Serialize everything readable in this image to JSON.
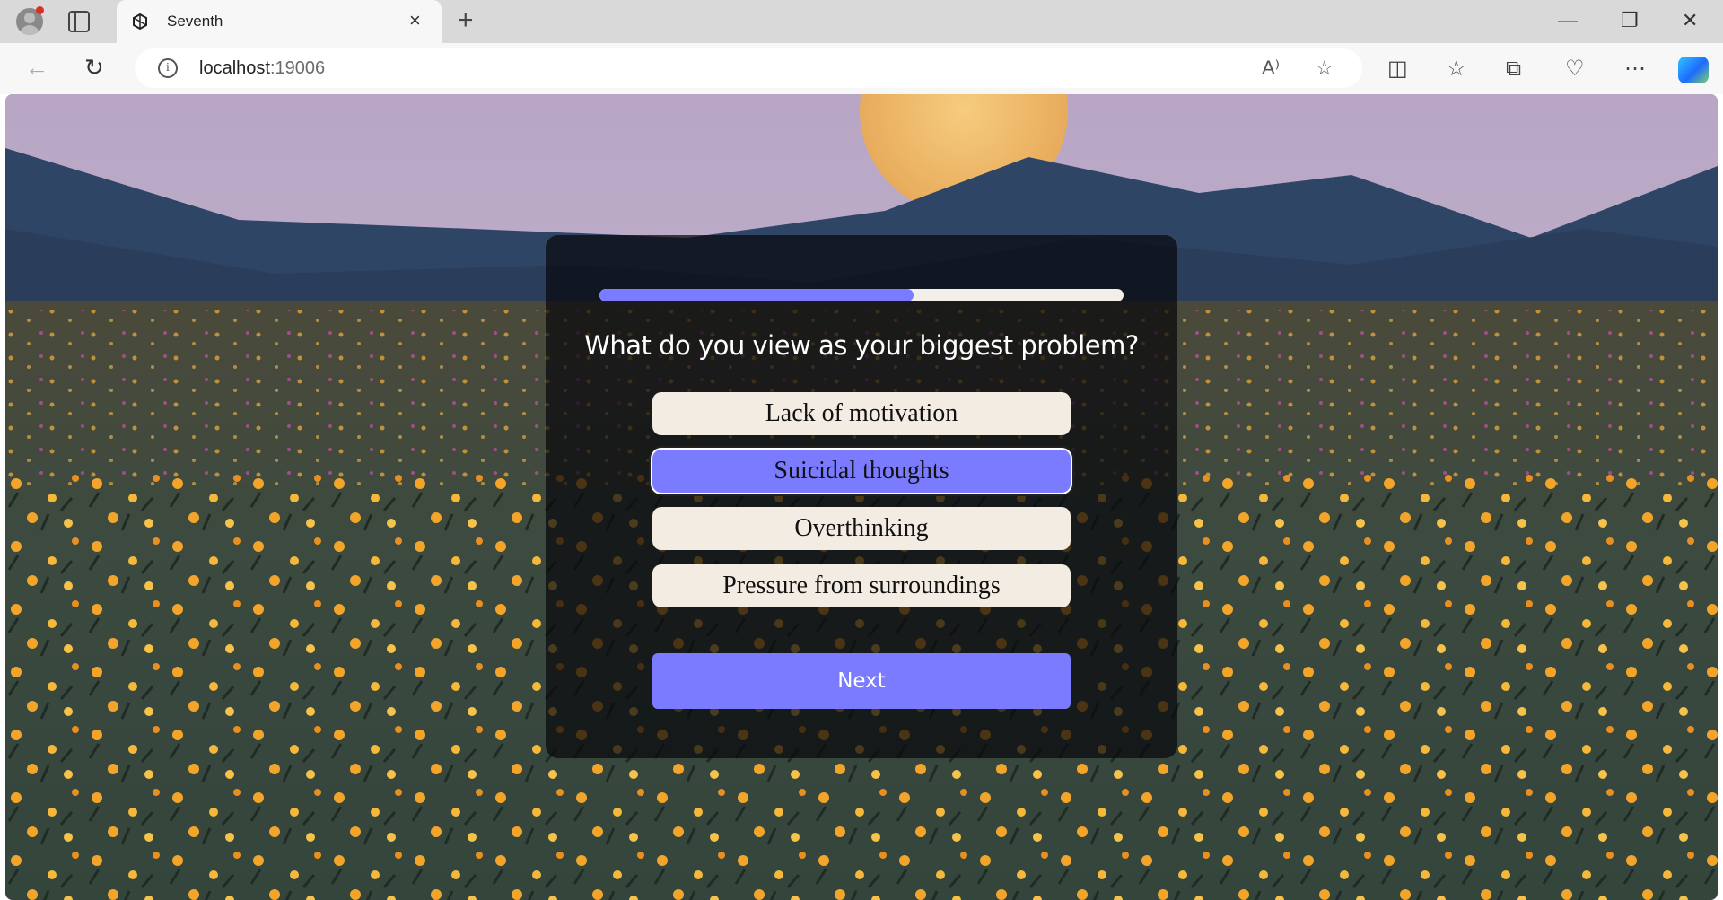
{
  "browser": {
    "tab_title": "Seventh",
    "tab_close": "×",
    "new_tab": "+",
    "url_host": "localhost",
    "url_port": ":19006",
    "window_controls": {
      "minimize": "—",
      "restore": "❐",
      "close": "✕"
    }
  },
  "icons": {
    "back": "arrow-left-icon",
    "refresh": "refresh-icon",
    "info": "info-icon",
    "read_aloud": "read-aloud-icon",
    "favorite": "star-icon",
    "split": "split-screen-icon",
    "favorites": "favorites-icon",
    "collections": "collections-icon",
    "health": "browser-essentials-icon",
    "more": "more-icon",
    "copilot": "copilot-icon"
  },
  "quiz": {
    "progress": 0.6,
    "question": "What do you view as your biggest problem?",
    "options": [
      {
        "label": "Lack of motivation",
        "selected": false
      },
      {
        "label": "Suicidal thoughts",
        "selected": true
      },
      {
        "label": "Overthinking",
        "selected": false
      },
      {
        "label": "Pressure from surroundings",
        "selected": false
      }
    ],
    "next_label": "Next"
  },
  "colors": {
    "accent": "#7b7bff",
    "option_bg": "#f3ece3",
    "card_bg": "rgba(8,8,12,0.72)"
  }
}
